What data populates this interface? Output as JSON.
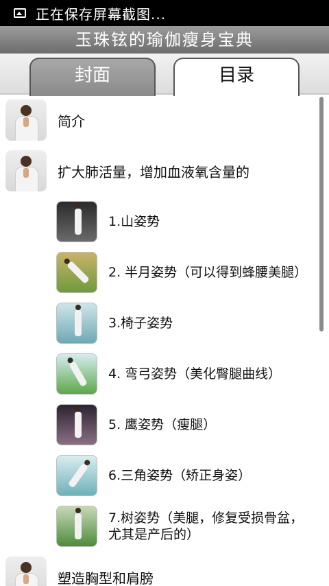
{
  "status_bar": {
    "icon": "image-icon",
    "text": "正在保存屏幕截图..."
  },
  "title_bar": {
    "title": "玉珠铉的瑜伽瘦身宝典"
  },
  "tabs": [
    {
      "label": "封面",
      "selected": false
    },
    {
      "label": "目录",
      "selected": true
    }
  ],
  "list": {
    "sections": [
      {
        "label": "简介"
      },
      {
        "label": "扩大肺活量，增加血液氧含量的"
      },
      {
        "label": "塑造胸型和肩膀"
      }
    ],
    "items": [
      {
        "label": "1.山姿势"
      },
      {
        "label": "2. 半月姿势（可以得到蜂腰美腿）"
      },
      {
        "label": "3.椅子姿势"
      },
      {
        "label": "4. 弯弓姿势（美化臀腿曲线）"
      },
      {
        "label": "5. 鹰姿势（瘦腿）"
      },
      {
        "label": "6.三角姿势（矫正身姿）"
      },
      {
        "label": "7.树姿势（美腿，修复受损骨盆，尤其是产后的）"
      }
    ]
  },
  "colors": {
    "status_bar_bg": "#000000",
    "title_bar_bg": "#7f7f7f",
    "tab_inactive_bg": "#9a9a9a",
    "tab_active_bg": "#ffffff"
  }
}
